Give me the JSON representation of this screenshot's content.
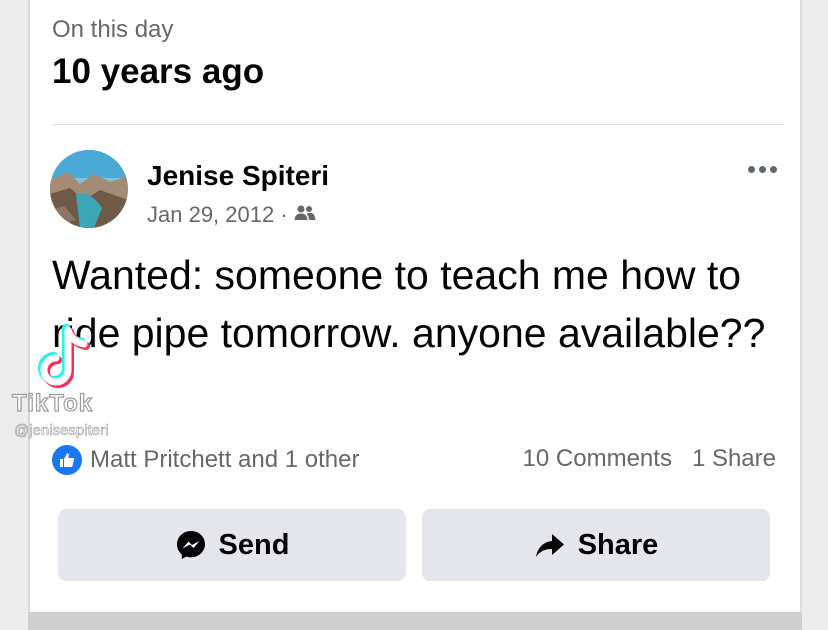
{
  "memory": {
    "label": "On this day",
    "title": "10 years ago"
  },
  "post": {
    "author": "Jenise Spiteri",
    "date": "Jan 29, 2012",
    "separator": "·",
    "audience_icon": "friends-icon",
    "text": "Wanted: someone to teach me how to ride pipe tomorrow. anyone available??"
  },
  "engagement": {
    "reactions_text": "Matt Pritchett and 1 other",
    "comments": "10 Comments",
    "shares": "1 Share"
  },
  "actions": {
    "send_label": "Send",
    "share_label": "Share"
  },
  "watermark": {
    "brand": "TikTok",
    "handle": "@jenisespiteri"
  },
  "colors": {
    "accent": "#1877f2",
    "secondary_text": "#65676b",
    "button_bg": "#e4e6eb"
  }
}
